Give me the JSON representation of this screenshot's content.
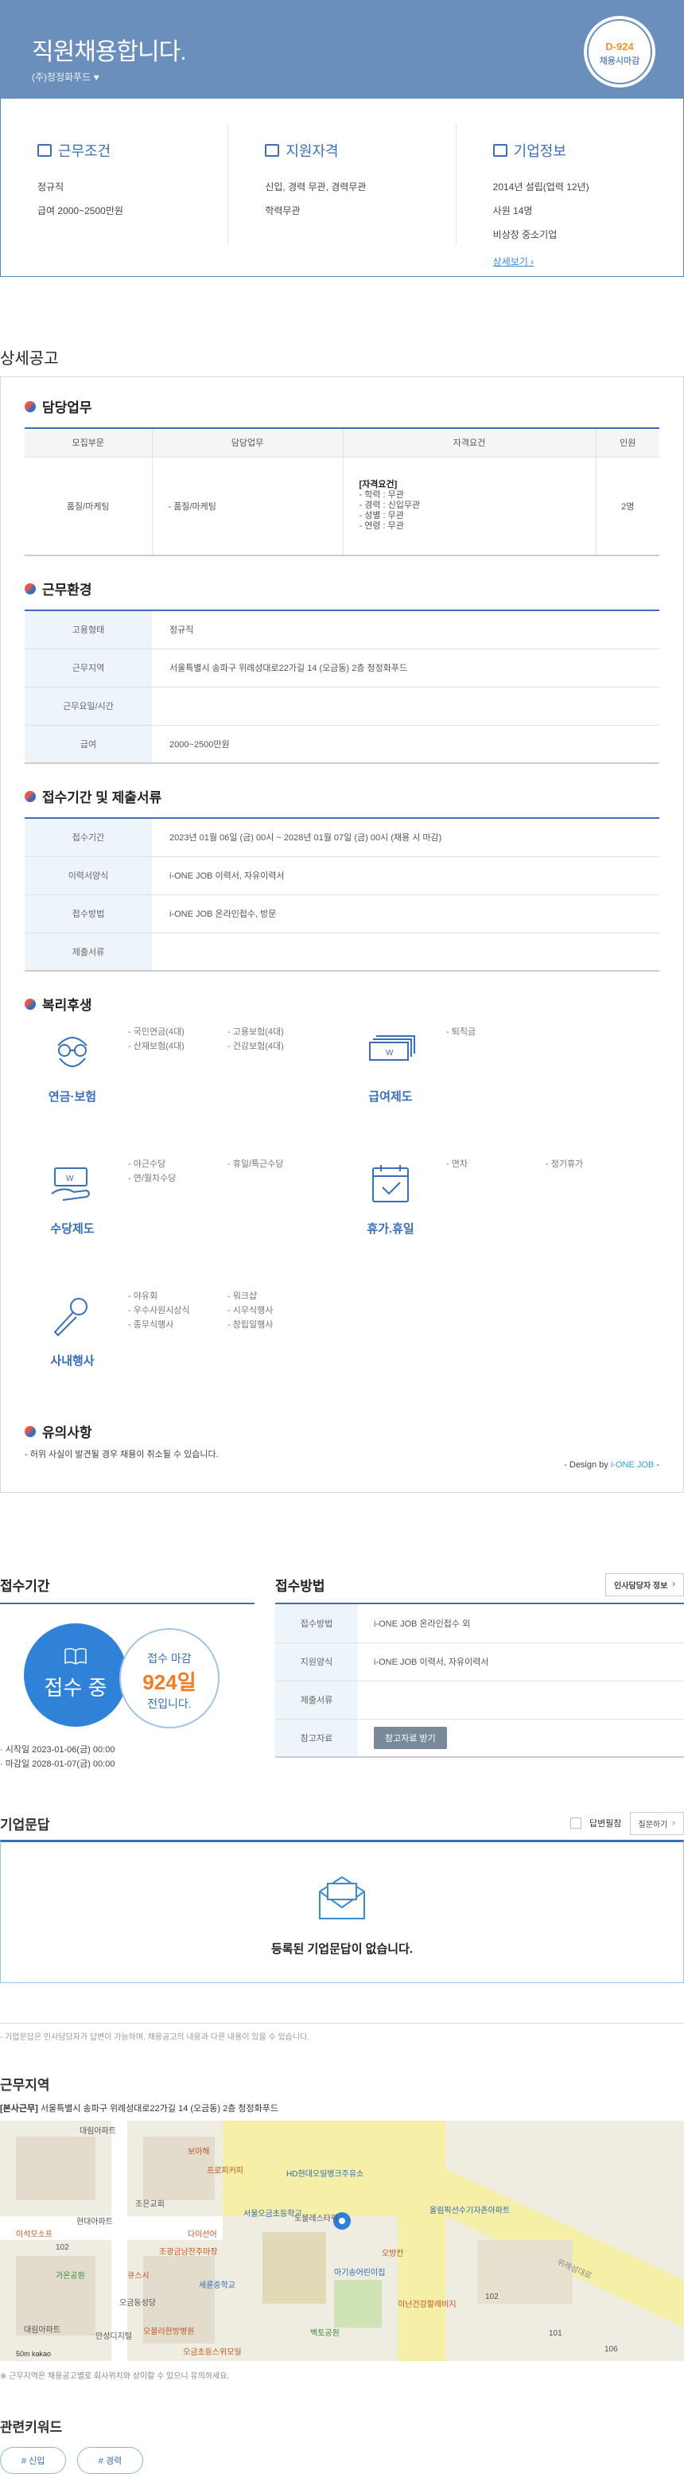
{
  "header": {
    "title": "직원채용합니다.",
    "company": "(주)청정화푸드",
    "dday": "D-924",
    "dday_label": "채용시마감"
  },
  "summary": {
    "conditions": {
      "title": "근무조건",
      "lines": [
        "정규직",
        "급여 2000~2500만원"
      ]
    },
    "qualification": {
      "title": "지원자격",
      "lines": [
        "신입, 경력 무관, 경력무관",
        "학력무관"
      ]
    },
    "company": {
      "title": "기업정보",
      "lines": [
        "2014년 설립(업력 12년)",
        "사원 14명",
        "비상장 중소기업"
      ],
      "more": "상세보기 ›"
    }
  },
  "detail": {
    "title": "상세공고",
    "duty": {
      "title": "담당업무",
      "headers": [
        "모집부문",
        "담당업무",
        "자격요건",
        "인원"
      ],
      "row": {
        "dept": "품질/마케팅",
        "task": "- 품질/마케팅",
        "req_title": "[자격요건]",
        "req": [
          "- 학력 : 무관",
          "- 경력 : 신입무관",
          "- 성별 : 무관",
          "- 연령 : 무관"
        ],
        "count": "2명"
      }
    },
    "env": {
      "title": "근무환경",
      "rows": [
        {
          "k": "고용형태",
          "v": "정규직"
        },
        {
          "k": "근무지역",
          "v": "서울특별시 송파구 위례성대로22가길 14 (오금동) 2층 청정화푸드"
        },
        {
          "k": "근무요일/시간",
          "v": ""
        },
        {
          "k": "급여",
          "v": "2000~2500만원"
        }
      ]
    },
    "apply": {
      "title": "접수기간 및 제출서류",
      "rows": [
        {
          "k": "접수기간",
          "v": "2023년 01월 06일 (금) 00시 ~ 2028년 01월 07일 (금) 00시 (채용 시 마감)"
        },
        {
          "k": "이력서양식",
          "v": "i-ONE JOB 이력서, 자유이력서"
        },
        {
          "k": "접수방법",
          "v": "i-ONE JOB 온라인접수, 방문"
        },
        {
          "k": "제출서류",
          "v": ""
        }
      ]
    },
    "welfare": {
      "title": "복리후생",
      "items": [
        {
          "name": "연금·보험",
          "icon": "glasses-person-icon",
          "list": [
            "- 국민연금(4대)",
            "- 고용보험(4대)",
            "- 산재보험(4대)",
            "- 건강보험(4대)"
          ]
        },
        {
          "name": "급여제도",
          "icon": "money-stack-icon",
          "list": [
            "- 퇴직금"
          ]
        },
        {
          "name": "수당제도",
          "icon": "money-hand-icon",
          "list": [
            "- 야근수당",
            "- 휴일/특근수당",
            "- 연/월차수당"
          ]
        },
        {
          "name": "휴가.휴일",
          "icon": "calendar-check-icon",
          "list": [
            "- 연차",
            "- 정기휴가"
          ]
        },
        {
          "name": "사내행사",
          "icon": "microphone-icon",
          "list": [
            "- 야유회",
            "- 워크샵",
            "- 우수사원시상식",
            "- 시무식행사",
            "- 종무식행사",
            "- 창립일행사"
          ]
        }
      ]
    },
    "caution": {
      "title": "유의사항",
      "text": "- 허위 사실이 발견될 경우 채용이 취소될 수 있습니다."
    },
    "design": {
      "prefix": "- Design by",
      "brand": "i-ONE JOB",
      "suffix": "-"
    }
  },
  "period": {
    "title": "접수기간",
    "status": "접수 중",
    "left_label": "접수 마감",
    "days": "924일",
    "left_suffix": "전입니다.",
    "start": "· 시작일 2023-01-06(금) 00:00",
    "end": "· 마감일 2028-01-07(금) 00:00"
  },
  "method": {
    "title": "접수방법",
    "hr_button": "인사담당자 정보",
    "rows": [
      {
        "k": "접수방법",
        "v": "i-ONE JOB 온라인접수 외"
      },
      {
        "k": "지원양식",
        "v": "i-ONE JOB 이력서, 자유이력서"
      },
      {
        "k": "제출서류",
        "v": ""
      },
      {
        "k": "참고자료",
        "v": ""
      }
    ],
    "ref_button": "참고자료 받기"
  },
  "qna": {
    "title": "기업문답",
    "check_label": "답변필참",
    "ask_button": "질문하기",
    "empty": "등록된 기업문답이 없습니다.",
    "note": "- 기업문답은 인사담당자가 답변이 가능하며, 채용공고의 내용과 다른 내용이 있을 수 있습니다."
  },
  "location": {
    "title": "근무지역",
    "tag": "[본사근무]",
    "address": "서울특별시 송파구 위례성대로22가길 14 (오금동) 2층 청정화푸드",
    "map_labels": [
      "대림아파트",
      "보아해",
      "프로피커피",
      "HD현대오일뱅크주유소",
      "조은교회",
      "서울오금초등학교",
      "노블레스타워",
      "현대아파트",
      "다미선어",
      "이석모소프",
      "102",
      "조광금남찬주마장",
      "가온공원",
      "큐스시",
      "세륜중학교",
      "아기송어린이집",
      "오방칸",
      "올림픽선수기자촌아파트",
      "오금동성당",
      "대림아파트",
      "안성디지털",
      "오블리한방병원",
      "오금초등스위모일",
      "백토공원",
      "위례성대로",
      "이난건강할례비지",
      "102",
      "101",
      "106",
      "50m",
      "kakao"
    ],
    "map_note": "※ 근무지역은 채용공고별로 회사위치와 상이할 수 있으니 유의하세요."
  },
  "keywords": {
    "title": "관련키워드",
    "tags": [
      "# 신입",
      "# 경력"
    ]
  },
  "colors": {
    "primary": "#3a6fb7",
    "hero": "#6b8fbd",
    "accent": "#f07d28"
  }
}
